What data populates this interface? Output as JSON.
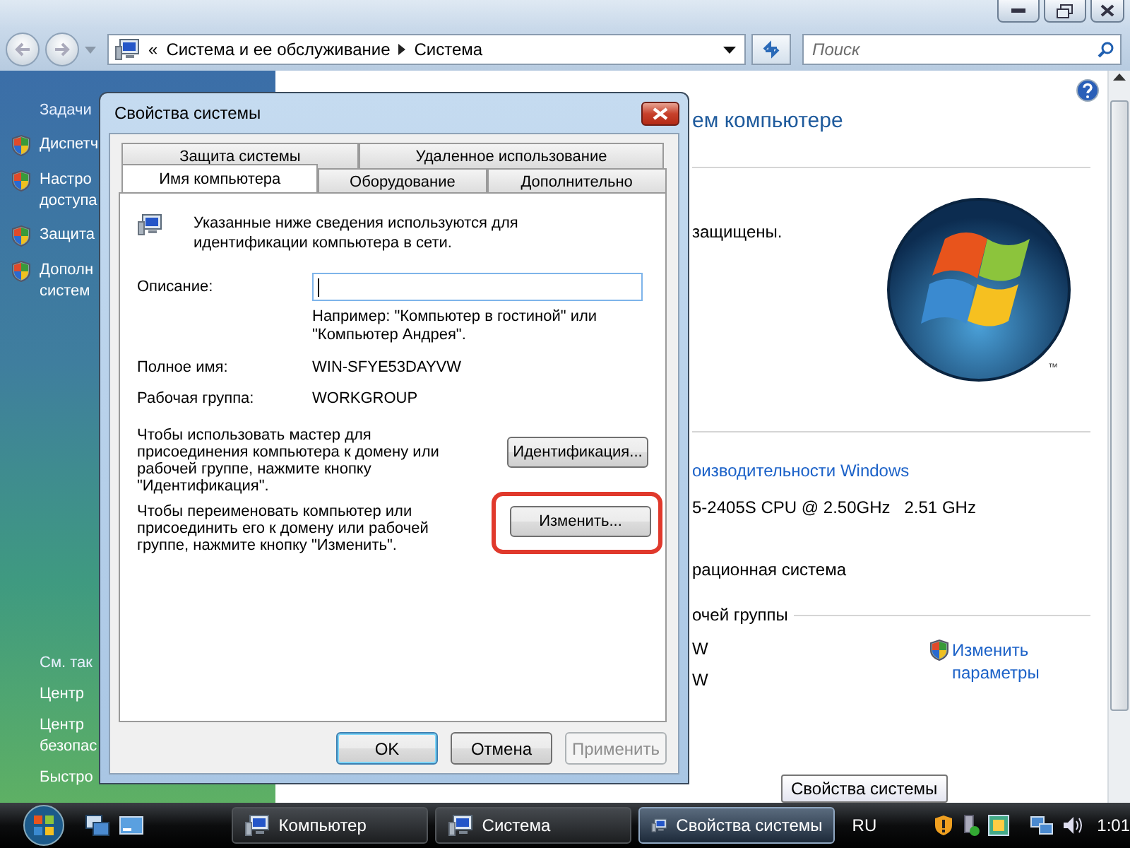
{
  "explorer": {
    "address": {
      "prefix": "«",
      "crumbs": [
        "Система и ее обслуживание",
        "Система"
      ]
    },
    "search": {
      "placeholder": "Поиск"
    },
    "sidebar": {
      "tasks_header": "Задачи",
      "tasks": [
        {
          "lines": [
            "Диспетч"
          ]
        },
        {
          "lines": [
            "Настро",
            "доступа"
          ]
        },
        {
          "lines": [
            "Защита"
          ]
        },
        {
          "lines": [
            "Дополн",
            "систем"
          ]
        }
      ],
      "see_also_header": "См. так",
      "see_also": [
        {
          "lines": [
            "Центр"
          ]
        },
        {
          "lines": [
            "Центр",
            "безопас"
          ]
        },
        {
          "lines": [
            "Быстро"
          ]
        }
      ]
    },
    "content": {
      "heading": "ем компьютере",
      "protection_text": "защищены.",
      "logo_mark": "™",
      "rating_link": "оизводительности Windows",
      "cpu": "5-2405S CPU @ 2.50GHz",
      "cpu_speed": "2.51 GHz",
      "os_type": "рационная система",
      "group_header": "очей группы",
      "values": [
        "W",
        "W"
      ],
      "change_link": "Изменить параметры"
    }
  },
  "dialog": {
    "title": "Свойства системы",
    "tab_rows": [
      [
        {
          "label": "Защита системы",
          "selected": false
        },
        {
          "label": "Удаленное использование",
          "selected": false
        }
      ],
      [
        {
          "label": "Имя компьютера",
          "selected": true
        },
        {
          "label": "Оборудование",
          "selected": false
        },
        {
          "label": "Дополнительно",
          "selected": false
        }
      ]
    ],
    "intro": "Указанные ниже сведения используются для идентификации компьютера в сети.",
    "description": {
      "label": "Описание:",
      "focused": true
    },
    "example": "Например: \"Компьютер в гостиной\" или \"Компьютер Андрея\".",
    "fields": [
      {
        "label": "Полное имя:",
        "value": "WIN-SFYE53DAYVW"
      },
      {
        "label": "Рабочая группа:",
        "value": "WORKGROUP"
      }
    ],
    "actions": [
      {
        "text": "Чтобы использовать мастер для присоединения компьютера к домену или рабочей группе, нажмите кнопку \"Идентификация\".",
        "button": "Идентификация...",
        "highlighted": false
      },
      {
        "text": "Чтобы переименовать компьютер или присоединить его к домену или рабочей группе, нажмите кнопку \"Изменить\".",
        "button": "Изменить...",
        "highlighted": true
      }
    ],
    "buttons": [
      {
        "label": "OK",
        "default": true,
        "disabled": false
      },
      {
        "label": "Отмена",
        "default": false,
        "disabled": false
      },
      {
        "label": "Применить",
        "default": false,
        "disabled": true
      }
    ]
  },
  "tooltip": {
    "text": "Свойства системы"
  },
  "taskbar": {
    "tasks": [
      {
        "label": "Компьютер",
        "selected": false
      },
      {
        "label": "Система",
        "selected": false
      },
      {
        "label": "Свойства системы",
        "selected": true
      }
    ],
    "language": "RU",
    "clock": "1:01"
  }
}
